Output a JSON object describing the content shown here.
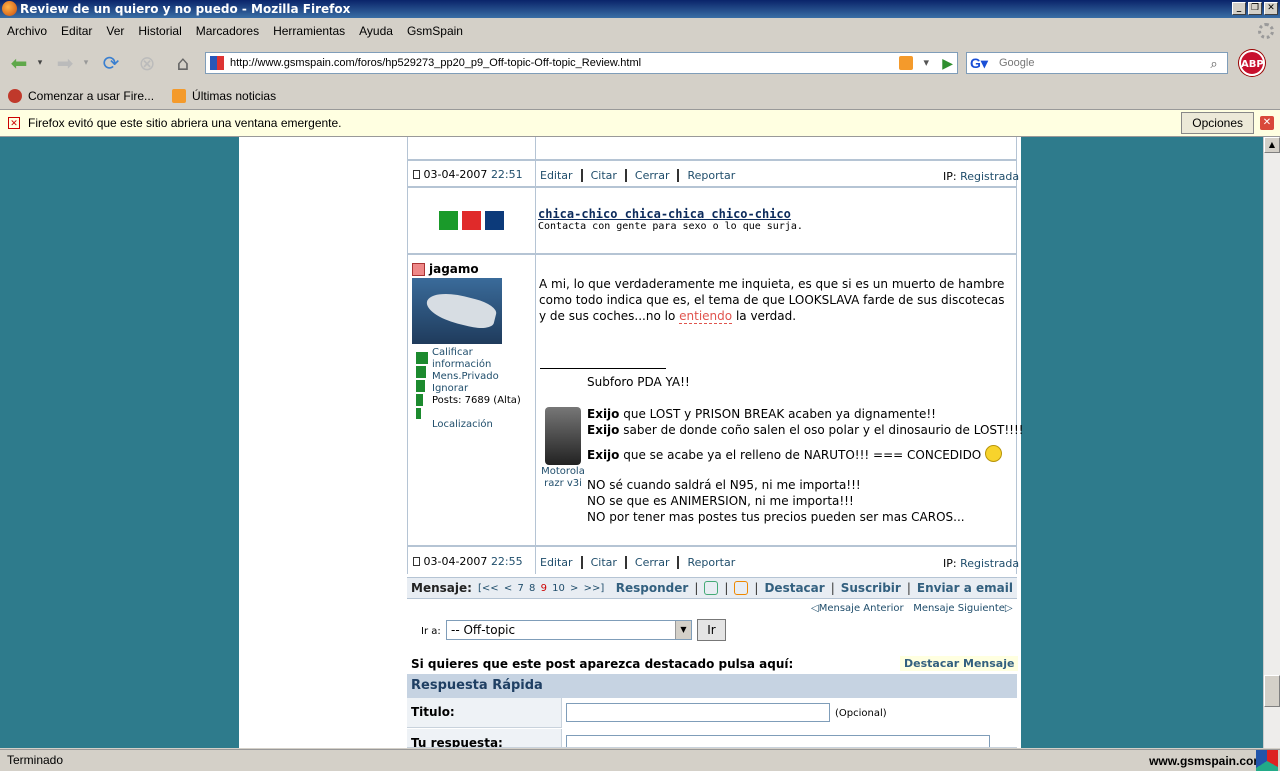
{
  "window": {
    "title": "Review de un quiero y no puedo - Mozilla Firefox"
  },
  "menu": [
    "Archivo",
    "Editar",
    "Ver",
    "Historial",
    "Marcadores",
    "Herramientas",
    "Ayuda",
    "GsmSpain"
  ],
  "toolbar": {
    "url": "http://www.gsmspain.com/foros/hp529273_pp20_p9_Off-topic-Off-topic_Review.html",
    "search_placeholder": "Google",
    "abp_label": "ABP"
  },
  "bookmarks": [
    "Comenzar a usar Fire...",
    "Últimas noticias"
  ],
  "popup_bar": {
    "message": "Firefox evitó que este sitio abriera una ventana emergente.",
    "options_label": "Opciones"
  },
  "post1": {
    "date": "03-04-2007",
    "time": "22:51",
    "actions": [
      "Editar",
      "Citar",
      "Cerrar",
      "Reportar"
    ],
    "ip_label": "IP:",
    "ip_value": "Registrada"
  },
  "ad": {
    "title": "chica-chico chica-chica chico-chico",
    "text": "Contacta con gente para sexo o lo que surja.",
    "colors": [
      "#1a9a2a",
      "#e02a2a",
      "#0c3a7a"
    ]
  },
  "post2": {
    "username": "jagamo",
    "user_links": [
      "Calificar",
      "información",
      "Mens.Privado",
      "Ignorar",
      "Posts: 7689 (Alta)",
      "",
      "Localización"
    ],
    "body_1": "A mi, lo que verdaderamente me inquieta, es que si es un muerto de hambre como todo indica que es, el tema de que LOOKSLAVA farde de sus discotecas y de sus coches...no lo",
    "body_link": "entiendo",
    "body_2": "la verdad.",
    "sig_line1": "Subforo PDA YA!!",
    "exijo": "Exijo",
    "sig_e1": "que LOST y PRISON BREAK acaben ya dignamente!!",
    "sig_e2": "saber de donde coño salen el oso polar y el dinosaurio de LOST!!!!",
    "sig_e3": "que se acabe ya el relleno de NARUTO!!! === CONCEDIDO",
    "phone_label_1": "Motorola",
    "phone_label_2": "razr v3i",
    "sig_n1": "NO sé cuando saldrá el N95, ni me importa!!!",
    "sig_n2": "NO se que es ANIMERSION, ni me importa!!!",
    "sig_n3": "NO por tener mas postes tus precios pueden ser mas CAROS...",
    "date": "03-04-2007",
    "time": "22:55",
    "actions": [
      "Editar",
      "Citar",
      "Cerrar",
      "Reportar"
    ],
    "ip_label": "IP:",
    "ip_value": "Registrada"
  },
  "message_bar": {
    "label": "Mensaje:",
    "pages": [
      "[<<",
      "<",
      "7",
      "8",
      "9",
      "10",
      ">",
      ">>]"
    ],
    "current_page": "9",
    "actions": [
      "Responder",
      "Destacar",
      "Suscribir",
      "Enviar a email"
    ],
    "prev": "Mensaje Anterior",
    "next": "Mensaje Siguiente"
  },
  "goto": {
    "label": "Ir a:",
    "selected": "-- Off-topic",
    "button": "Ir"
  },
  "highlight": {
    "text": "Si quieres que este post aparezca destacado pulsa aquí:",
    "button": "Destacar Mensaje"
  },
  "quick_reply": {
    "title": "Respuesta Rápida",
    "title_label": "Titulo:",
    "optional": "(Opcional)",
    "reply_label": "Tu respuesta:"
  },
  "status": {
    "text": "Terminado",
    "watermark": "www.gsmspain.com"
  }
}
